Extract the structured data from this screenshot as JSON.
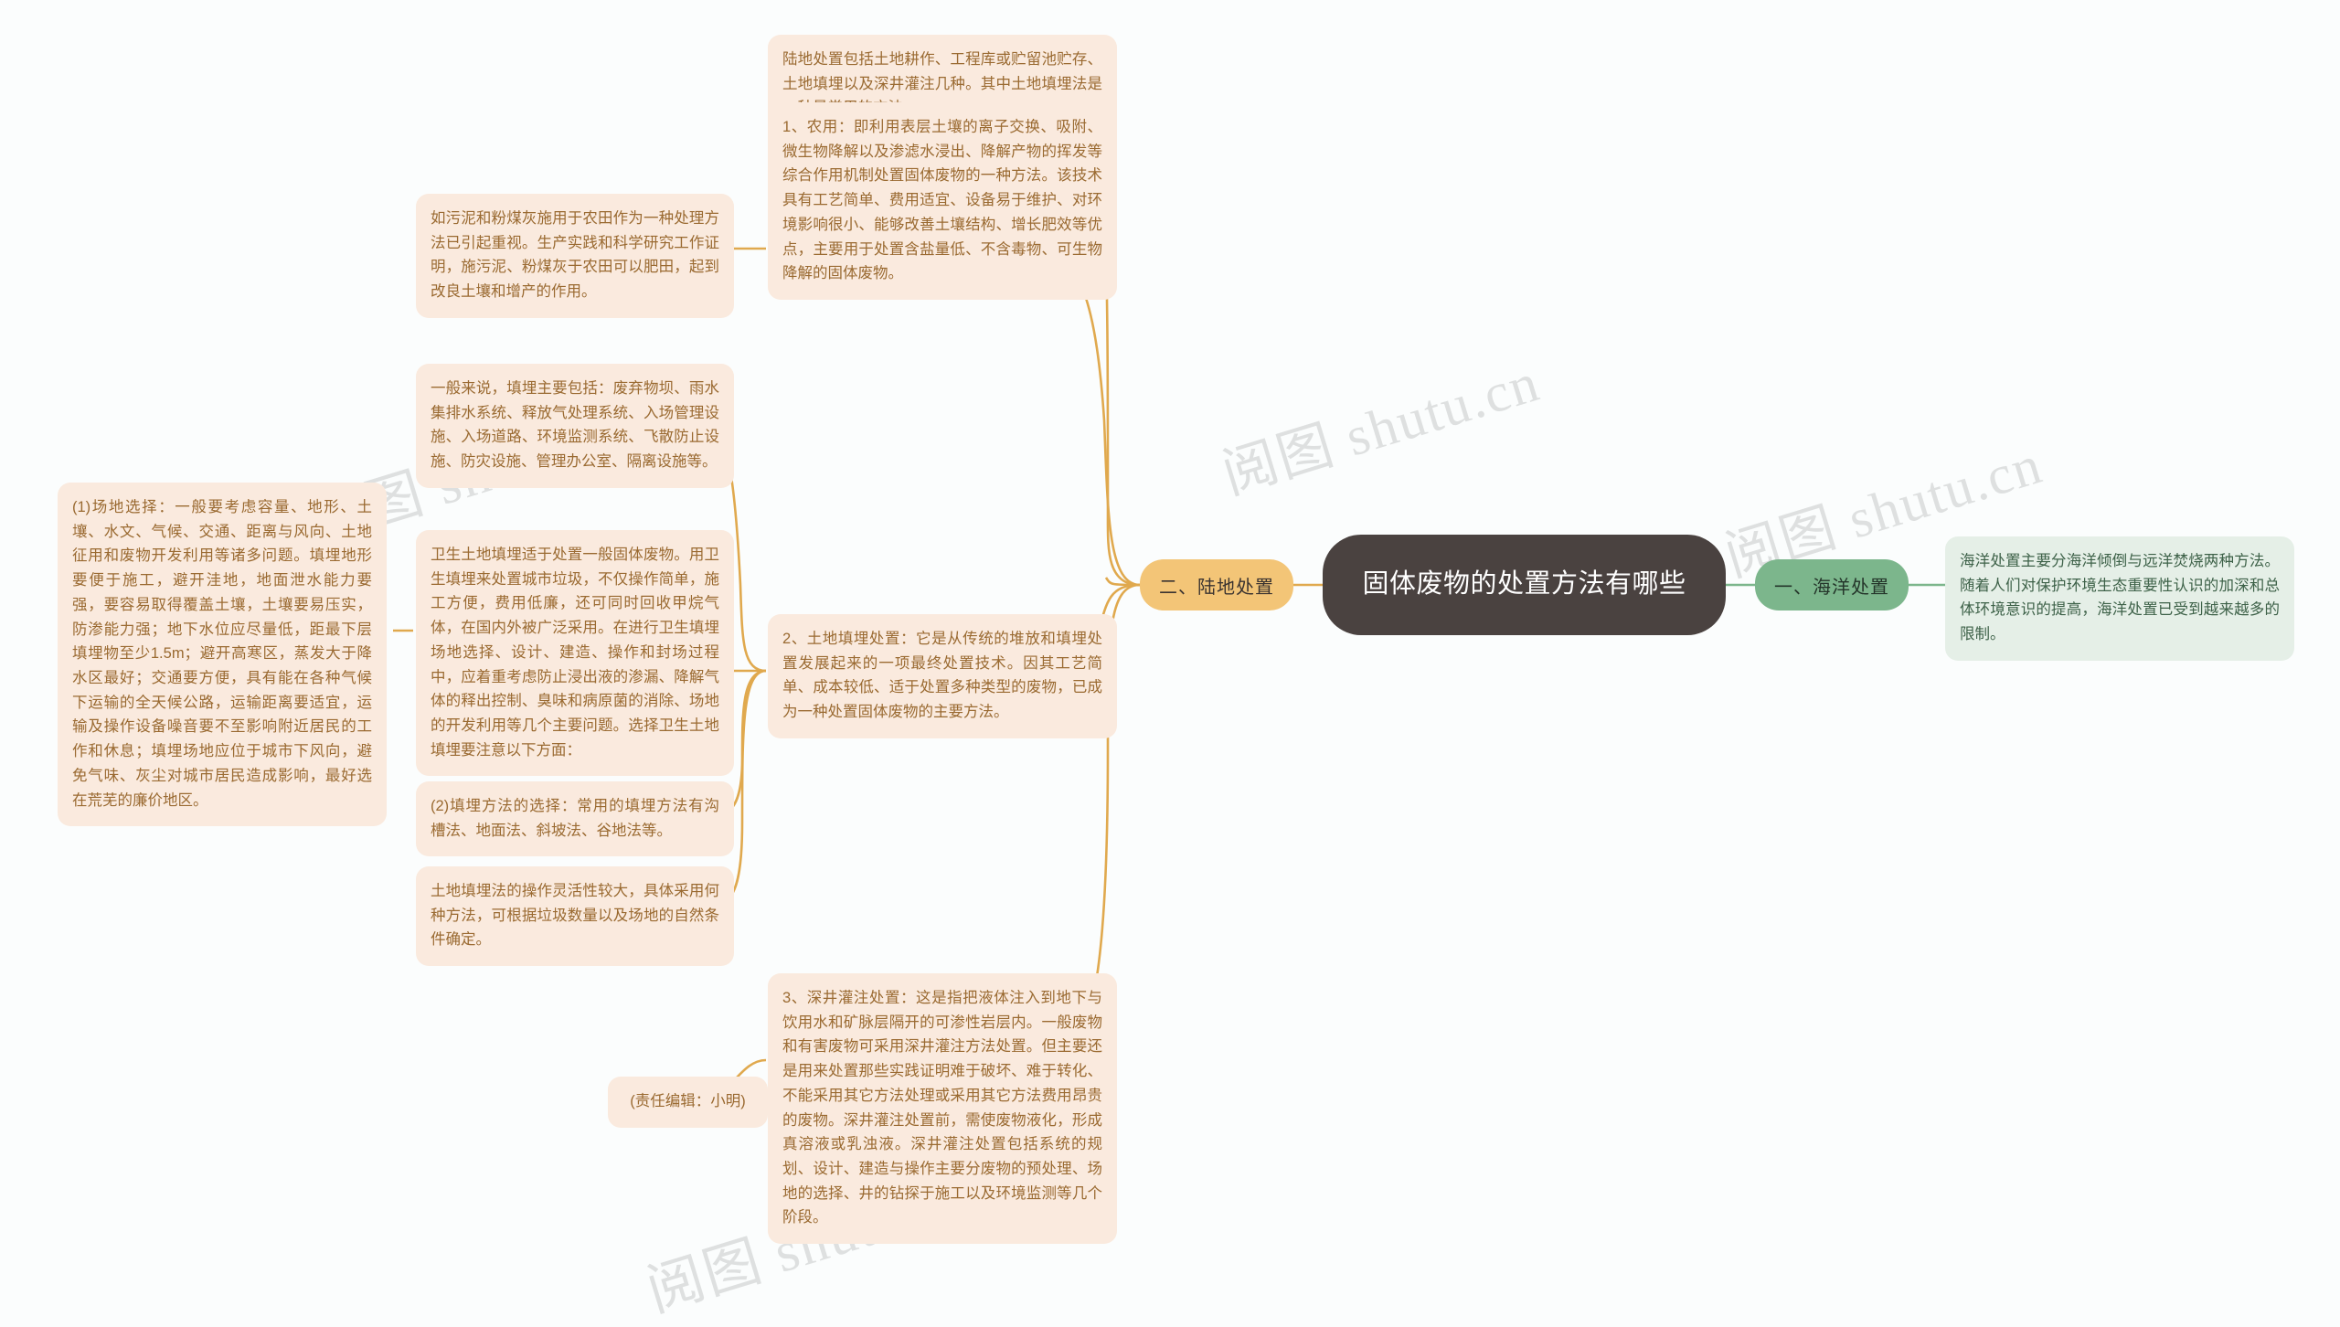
{
  "theme": {
    "background": "#fbfdfd",
    "root_fill": "#4a4240",
    "root_text": "#ffffff",
    "branch_orange_fill": "#f3c577",
    "branch_green_fill": "#7cb68c",
    "leaf_orange_fill": "#faeade",
    "leaf_orange_text": "#9a6a31",
    "leaf_green_fill": "#e5efe7",
    "leaf_green_text": "#3d6148",
    "connector_orange": "#e0a94e",
    "connector_green": "#7cb68c",
    "watermark_color": "#d9dcdc"
  },
  "root": {
    "title": "固体废物的处置方法有哪些"
  },
  "branches": [
    {
      "id": "land",
      "label": "二、陆地处置"
    },
    {
      "id": "ocean",
      "label": "一、海洋处置"
    }
  ],
  "ocean_detail": "海洋处置主要分海洋倾倒与远洋焚烧两种方法。随着人们对保护环境生态重要性认识的加深和总体环境意识的提高，海洋处置已受到越来越多的限制。",
  "land_children": [
    {
      "id": "land-intro",
      "text": "陆地处置包括土地耕作、工程库或贮留池贮存、土地填埋以及深井灌注几种。其中土地填埋法是一种最常用的方法。"
    },
    {
      "id": "agri-use",
      "text": "1、农用：即利用表层土壤的离子交换、吸附、微生物降解以及渗滤水浸出、降解产物的挥发等综合作用机制处置固体废物的一种方法。该技术具有工艺简单、费用适宜、设备易于维护、对环境影响很小、能够改善土壤结构、增长肥效等优点，主要用于处置含盐量低、不含毒物、可生物降解的固体废物。"
    },
    {
      "id": "landfill",
      "text": "2、土地填埋处置：它是从传统的堆放和填埋处置发展起来的一项最终处置技术。因其工艺简单、成本较低、适于处置多种类型的废物，已成为一种处置固体废物的主要方法。"
    },
    {
      "id": "deep-well",
      "text": "3、深井灌注处置：这是指把液体注入到地下与饮用水和矿脉层隔开的可渗性岩层内。一般废物和有害废物可采用深井灌注方法处置。但主要还是用来处置那些实践证明难于破坏、难于转化、不能采用其它方法处理或采用其它方法费用昂贵的废物。深井灌注处置前，需使废物液化，形成真溶液或乳浊液。深井灌注处置包括系统的规划、设计、建造与操作主要分废物的预处理、场地的选择、井的钻探于施工以及环境监测等几个阶段。"
    }
  ],
  "agri_children": [
    {
      "id": "sludge-flyash",
      "text": "如污泥和粉煤灰施用于农田作为一种处理方法已引起重视。生产实践和科学研究工作证明，施污泥、粉煤灰于农田可以肥田，起到改良土壤和增产的作用。"
    }
  ],
  "landfill_children": [
    {
      "id": "landfill-components",
      "text": "一般来说，填埋主要包括：废弃物坝、雨水集排水系统、释放气处理系统、入场管理设施、入场道路、环境监测系统、飞散防止设施、防灾设施、管理办公室、隔离设施等。"
    },
    {
      "id": "sanitary-landfill",
      "text": "卫生土地填埋适于处置一般固体废物。用卫生填埋来处置城市垃圾，不仅操作简单，施工方便，费用低廉，还可同时回收甲烷气体，在国内外被广泛采用。在进行卫生填埋场地选择、设计、建造、操作和封场过程中，应着重考虑防止浸出液的渗漏、降解气体的释出控制、臭味和病原菌的消除、场地的开发利用等几个主要问题。选择卫生土地填埋要注意以下方面："
    },
    {
      "id": "method-choice",
      "text": "(2)填埋方法的选择：常用的填埋方法有沟槽法、地面法、斜坡法、谷地法等。"
    },
    {
      "id": "flexibility",
      "text": "土地填埋法的操作灵活性较大，具体采用何种方法，可根据垃圾数量以及场地的自然条件确定。"
    }
  ],
  "sanitary_children": [
    {
      "id": "site-selection",
      "text": "(1)场地选择：一般要考虑容量、地形、土壤、水文、气候、交通、距离与风向、土地征用和废物开发利用等诸多问题。填埋地形要便于施工，避开洼地，地面泄水能力要强，要容易取得覆盖土壤，土壤要易压实，防渗能力强；地下水位应尽量低，距最下层填埋物至少1.5m；避开高寒区，蒸发大于降水区最好；交通要方便，具有能在各种气候下运输的全天候公路，运输距离要适宜，运输及操作设备噪音要不至影响附近居民的工作和休息；填埋场地应位于城市下风向，避免气味、灰尘对城市居民造成影响，最好选在荒芜的廉价地区。"
    }
  ],
  "footer": {
    "editor_note": "(责任编辑：小明)"
  },
  "watermarks": [
    {
      "id": "wm-1",
      "text": "阅图 shutu.cn"
    },
    {
      "id": "wm-2",
      "text": "阅图 shutu.cn"
    },
    {
      "id": "wm-3",
      "text": "阅图 shutu.cn"
    },
    {
      "id": "wm-4",
      "text": "阅图 shutu.cn"
    }
  ]
}
